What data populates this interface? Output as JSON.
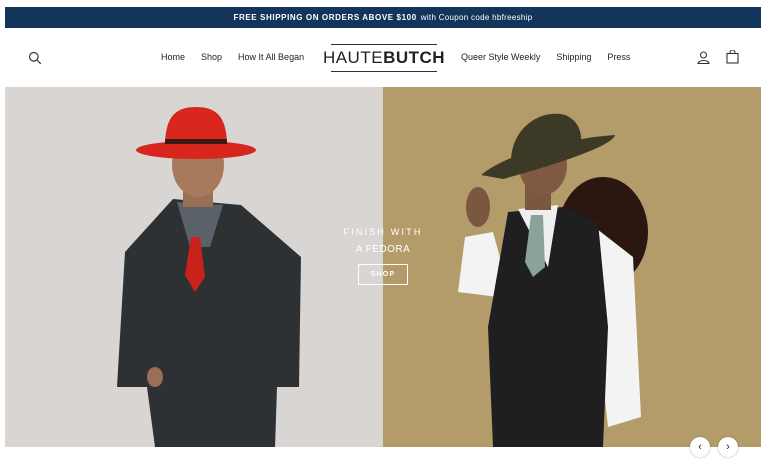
{
  "announcement": {
    "bold": "FREE SHIPPING ON ORDERS ABOVE $100",
    "rest": "with Coupon code hbfreeship"
  },
  "logo": {
    "thin": "HAUTE",
    "bold": "BUTCH"
  },
  "nav_left": [
    "Home",
    "Shop",
    "How It All Began"
  ],
  "nav_right": [
    "Queer Style Weekly",
    "Shipping",
    "Press"
  ],
  "hero": {
    "line1": "FINISH WITH",
    "line2": "A FEDORA",
    "cta": "SHOP"
  },
  "colors": {
    "announcement_bg": "#14355b",
    "hero_left_bg": "#d8d5d3",
    "hero_right_bg": "#b39c69",
    "hat_red": "#d8261e"
  },
  "icons": [
    "search-icon",
    "account-icon",
    "cart-icon",
    "chevron-left-icon",
    "chevron-right-icon"
  ]
}
